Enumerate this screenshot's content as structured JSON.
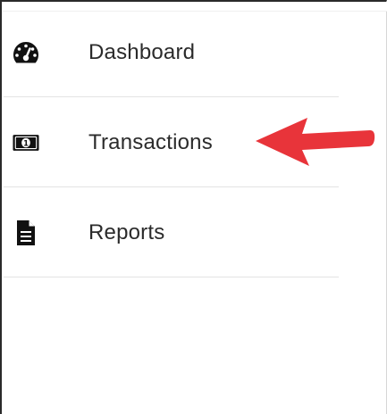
{
  "sidebar": {
    "items": [
      {
        "label": "Dashboard",
        "icon": "speedometer-icon"
      },
      {
        "label": "Transactions",
        "icon": "money-bill-icon"
      },
      {
        "label": "Reports",
        "icon": "document-icon"
      }
    ]
  },
  "annotation": {
    "arrow_color": "#e8343a",
    "points_to": "Transactions"
  }
}
